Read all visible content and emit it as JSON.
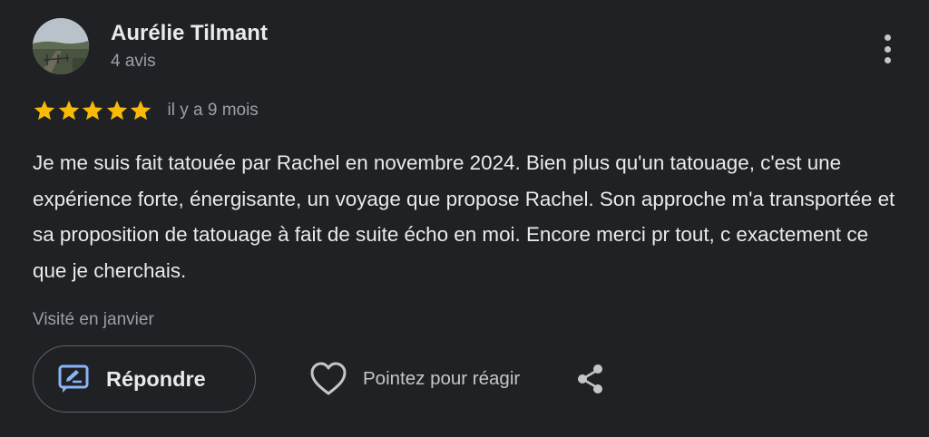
{
  "review": {
    "author": {
      "name": "Aurélie Tilmant",
      "meta": "4 avis",
      "avatar": "avatar-landscape-photo"
    },
    "rating": 5,
    "max_rating": 5,
    "date": "il y a 9 mois",
    "text": "Je me suis fait tatouée par Rachel en novembre 2024. Bien plus qu'un tatouage, c'est une expérience forte, énergisante, un voyage que propose Rachel. Son approche m'a transportée et sa proposition de tatouage à fait de suite écho en moi. Encore merci pr tout, c exactement ce que je cherchais.",
    "visit": "Visité en janvier"
  },
  "actions": {
    "reply_label": "Répondre",
    "react_label": "Pointez pour réagir",
    "reply_icon": "reply-icon",
    "react_icon": "heart-icon",
    "share_icon": "share-icon",
    "more_icon": "more-vert-icon"
  },
  "colors": {
    "background": "#202124",
    "star": "#f6bb06",
    "reply_icon": "#8ab4f8",
    "text_primary": "#e8eaed",
    "text_secondary": "#9aa0a6"
  }
}
